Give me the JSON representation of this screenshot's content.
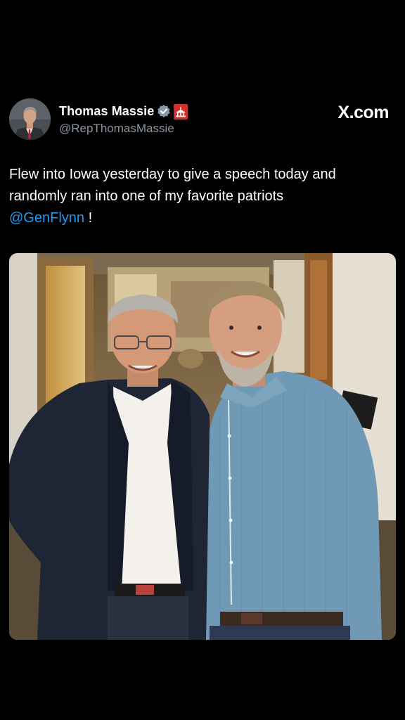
{
  "author": {
    "display_name": "Thomas Massie",
    "handle": "@RepThomasMassie",
    "verified_icon": "verified-badge-icon",
    "affiliation_icon": "government-affiliation-icon",
    "verified_color": "#829aab",
    "affiliation_color": "#d0312d"
  },
  "source": {
    "label": "X.com"
  },
  "tweet": {
    "line1": "Flew into Iowa yesterday to give a speech today and",
    "line2": "randomly ran into one of my favorite patriots",
    "mention": "@GenFlynn",
    "trailing": "!"
  },
  "media": {
    "type": "photo"
  },
  "colors": {
    "background": "#000000",
    "text": "#ffffff",
    "secondary_text": "#8b949e",
    "link": "#1d9bf0"
  }
}
